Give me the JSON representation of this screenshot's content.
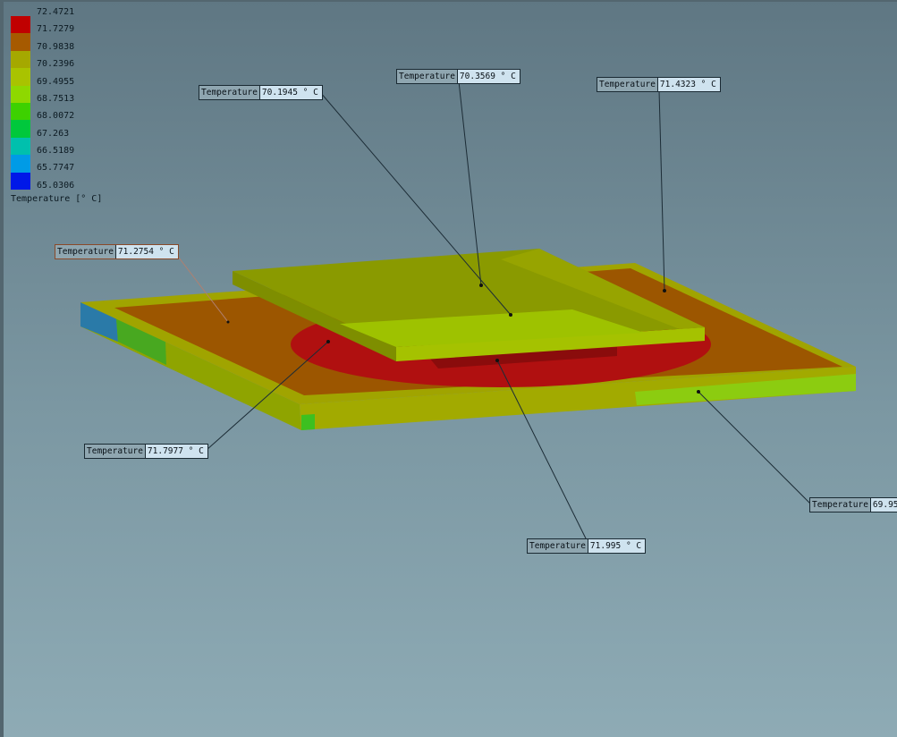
{
  "legend": {
    "title": "Temperature [° C]",
    "values": [
      "72.4721",
      "71.7279",
      "70.9838",
      "70.2396",
      "69.4955",
      "68.7513",
      "68.0072",
      "67.263",
      "66.5189",
      "65.7747",
      "65.0306"
    ],
    "colors": [
      "#c00000",
      "#a65a00",
      "#a5a800",
      "#a9c300",
      "#8ed800",
      "#3dd100",
      "#00c83c",
      "#00c0ad",
      "#009be6",
      "#005de6",
      "#0018e8"
    ]
  },
  "probes": [
    {
      "name": "Temperature",
      "value": "70.1945 ° C"
    },
    {
      "name": "Temperature",
      "value": "70.3569 ° C"
    },
    {
      "name": "Temperature",
      "value": "71.4323 ° C"
    },
    {
      "name": "Temperature",
      "value": "71.2754 ° C"
    },
    {
      "name": "Temperature",
      "value": "71.7977 ° C"
    },
    {
      "name": "Temperature",
      "value": "71.995 ° C"
    },
    {
      "name": "Temperature",
      "value": "69.95"
    }
  ]
}
